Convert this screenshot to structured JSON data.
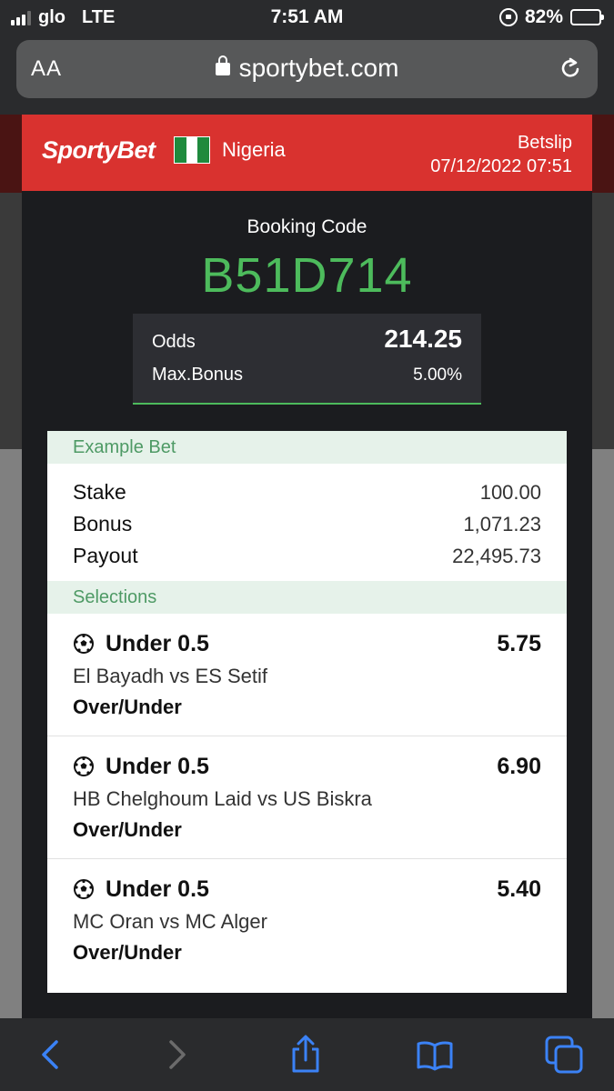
{
  "status_bar": {
    "carrier": "glo",
    "network": "LTE",
    "time": "7:51 AM",
    "battery": "82%",
    "battery_level": 0.82
  },
  "browser": {
    "text_size_label": "AA",
    "url": "sportybet.com"
  },
  "header": {
    "logo": "SportyBet",
    "country": "Nigeria",
    "betslip_label": "Betslip",
    "datetime": "07/12/2022 07:51"
  },
  "booking": {
    "label": "Booking Code",
    "code": "B51D714"
  },
  "summary": {
    "odds_label": "Odds",
    "odds_value": "214.25",
    "max_bonus_label": "Max.Bonus",
    "max_bonus_value": "5.00%"
  },
  "example_bet": {
    "title": "Example Bet",
    "rows": [
      {
        "label": "Stake",
        "value": "100.00"
      },
      {
        "label": "Bonus",
        "value": "1,071.23"
      },
      {
        "label": "Payout",
        "value": "22,495.73"
      }
    ]
  },
  "selections": {
    "title": "Selections",
    "items": [
      {
        "pick": "Under 0.5",
        "odds": "5.75",
        "match": "El Bayadh vs ES Setif",
        "market": "Over/Under"
      },
      {
        "pick": "Under 0.5",
        "odds": "6.90",
        "match": "HB Chelghoum Laid vs US Biskra",
        "market": "Over/Under"
      },
      {
        "pick": "Under 0.5",
        "odds": "5.40",
        "match": "MC Oran vs MC Alger",
        "market": "Over/Under"
      }
    ]
  },
  "colors": {
    "brand_red": "#d9322f",
    "code_green": "#4dbb5c",
    "ios_blue": "#3b82f6"
  },
  "icons": {
    "back": "chevron-left-icon",
    "forward": "chevron-right-icon",
    "share": "share-icon",
    "bookmarks": "book-icon",
    "tabs": "tabs-icon",
    "sport": "soccer-ball-icon"
  }
}
